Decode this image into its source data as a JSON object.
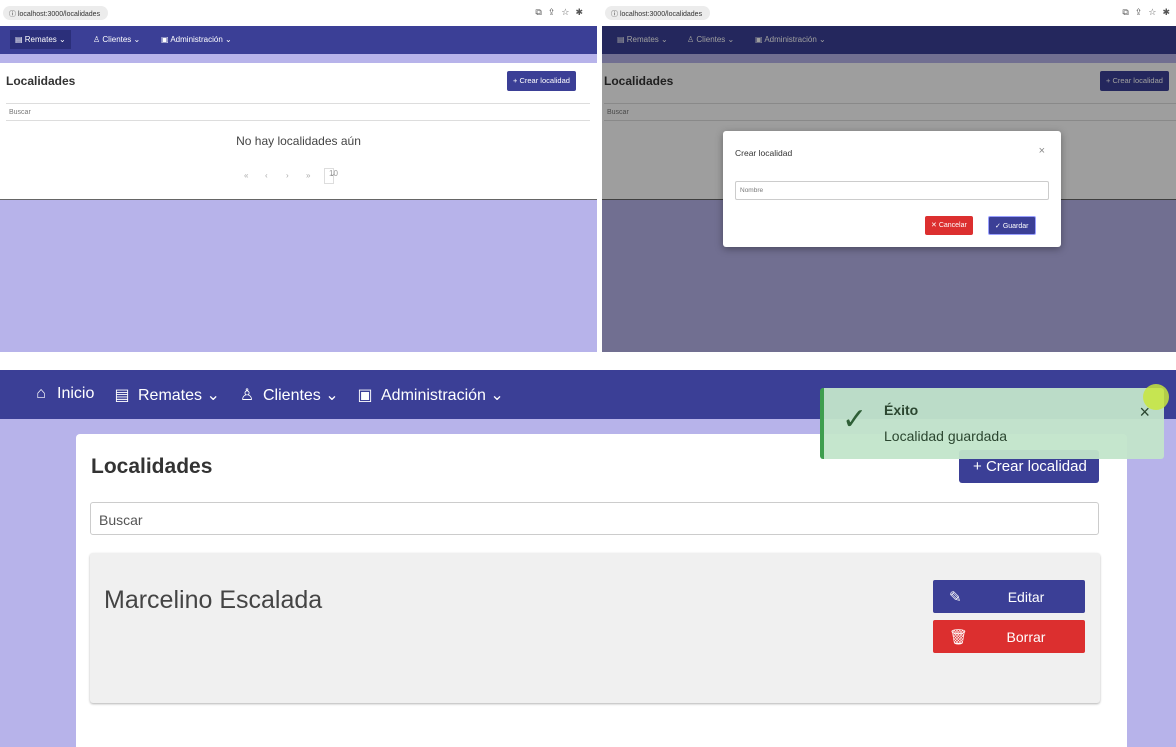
{
  "browser": {
    "url": "localhost:3000/localidades",
    "icons": [
      "open-in-window-icon",
      "share-icon",
      "star-icon",
      "extensions-icon"
    ]
  },
  "mini_nav": {
    "remates": "Remates",
    "clientes": "Clientes",
    "administracion": "Administración"
  },
  "list_page": {
    "title": "Localidades",
    "create_label": "Crear localidad",
    "search_placeholder": "Buscar",
    "empty_text": "No hay localidades aún",
    "pager": {
      "first": "«",
      "prev": "‹",
      "next": "›",
      "last": "»",
      "page_size": "10"
    }
  },
  "modal": {
    "title": "Crear localidad",
    "close": "×",
    "field_placeholder": "Nombre",
    "cancel_label": "Cancelar",
    "save_label": "Guardar"
  },
  "main_nav": {
    "inicio": "Inicio",
    "remates": "Remates",
    "clientes": "Clientes",
    "administracion": "Administración"
  },
  "main": {
    "title": "Localidades",
    "create_label": "Crear localidad",
    "search_placeholder": "Buscar",
    "items": [
      {
        "name": "Marcelino Escalada",
        "edit_label": "Editar",
        "delete_label": "Borrar"
      }
    ]
  },
  "toast": {
    "title": "Éxito",
    "message": "Localidad guardada",
    "close": "×"
  },
  "colors": {
    "navbar": "#3b3f96",
    "background": "#b7b3ea",
    "danger": "#dc2f2f",
    "success_bg": "#c2e5ca"
  }
}
